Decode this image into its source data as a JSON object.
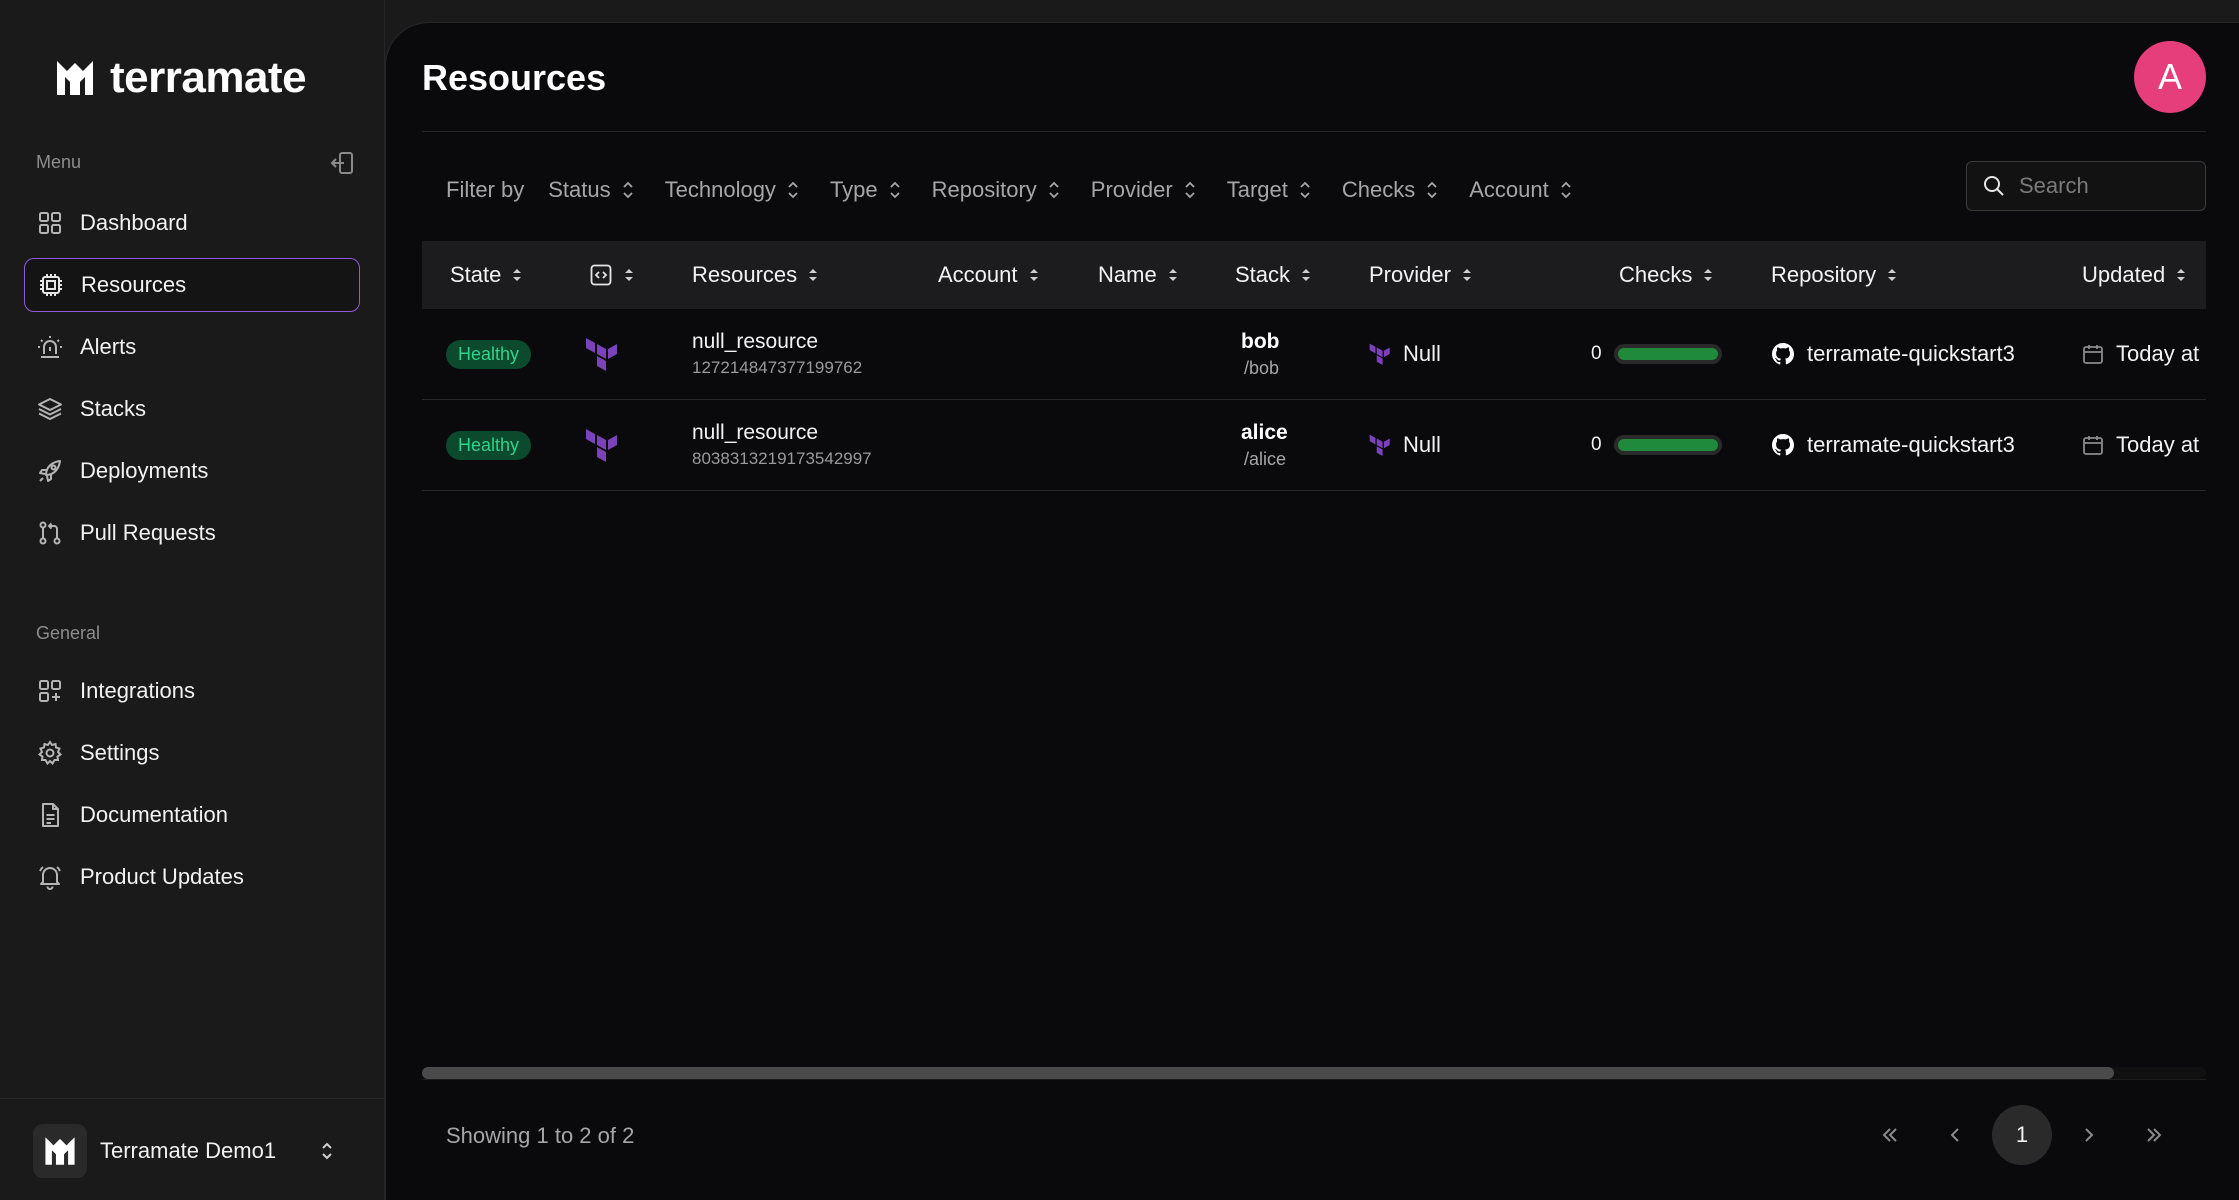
{
  "app": {
    "name": "terramate"
  },
  "sidebar": {
    "menu_label": "Menu",
    "general_label": "General",
    "menu_items": [
      {
        "label": "Dashboard",
        "icon": "grid-icon"
      },
      {
        "label": "Resources",
        "icon": "chip-icon",
        "active": true
      },
      {
        "label": "Alerts",
        "icon": "siren-icon"
      },
      {
        "label": "Stacks",
        "icon": "layers-icon"
      },
      {
        "label": "Deployments",
        "icon": "rocket-icon"
      },
      {
        "label": "Pull Requests",
        "icon": "git-pull-request-icon"
      }
    ],
    "general_items": [
      {
        "label": "Integrations",
        "icon": "grid-plus-icon"
      },
      {
        "label": "Settings",
        "icon": "gear-icon"
      },
      {
        "label": "Documentation",
        "icon": "document-icon"
      },
      {
        "label": "Product Updates",
        "icon": "bell-icon"
      }
    ],
    "organization": "Terramate Demo1"
  },
  "header": {
    "title": "Resources",
    "user_initial": "A"
  },
  "filters": {
    "label": "Filter by",
    "items": [
      "Status",
      "Technology",
      "Type",
      "Repository",
      "Provider",
      "Target",
      "Checks",
      "Account"
    ],
    "search_placeholder": "Search"
  },
  "table": {
    "columns": [
      "State",
      "",
      "Resources",
      "Account",
      "Name",
      "Stack",
      "Provider",
      "Checks",
      "Repository",
      "Updated"
    ],
    "rows": [
      {
        "state": "Healthy",
        "resource": "null_resource",
        "resource_id": "127214847377199762",
        "account": "",
        "name": "",
        "stack": "bob",
        "stack_path": "/bob",
        "provider": "Null",
        "checks": "0",
        "checks_passed_fraction": 1.0,
        "repository": "terramate-quickstart3",
        "updated": "Today at"
      },
      {
        "state": "Healthy",
        "resource": "null_resource",
        "resource_id": "8038313219173542997",
        "account": "",
        "name": "",
        "stack": "alice",
        "stack_path": "/alice",
        "provider": "Null",
        "checks": "0",
        "checks_passed_fraction": 1.0,
        "repository": "terramate-quickstart3",
        "updated": "Today at"
      }
    ]
  },
  "footer": {
    "showing": "Showing 1 to 2 of 2",
    "current_page": "1"
  },
  "colors": {
    "accent": "#8f5ad6",
    "avatar": "#e63e7a",
    "healthy_text": "#2fd38a",
    "healthy_bg": "#0c4a2e",
    "terraform": "#7b42bc"
  }
}
